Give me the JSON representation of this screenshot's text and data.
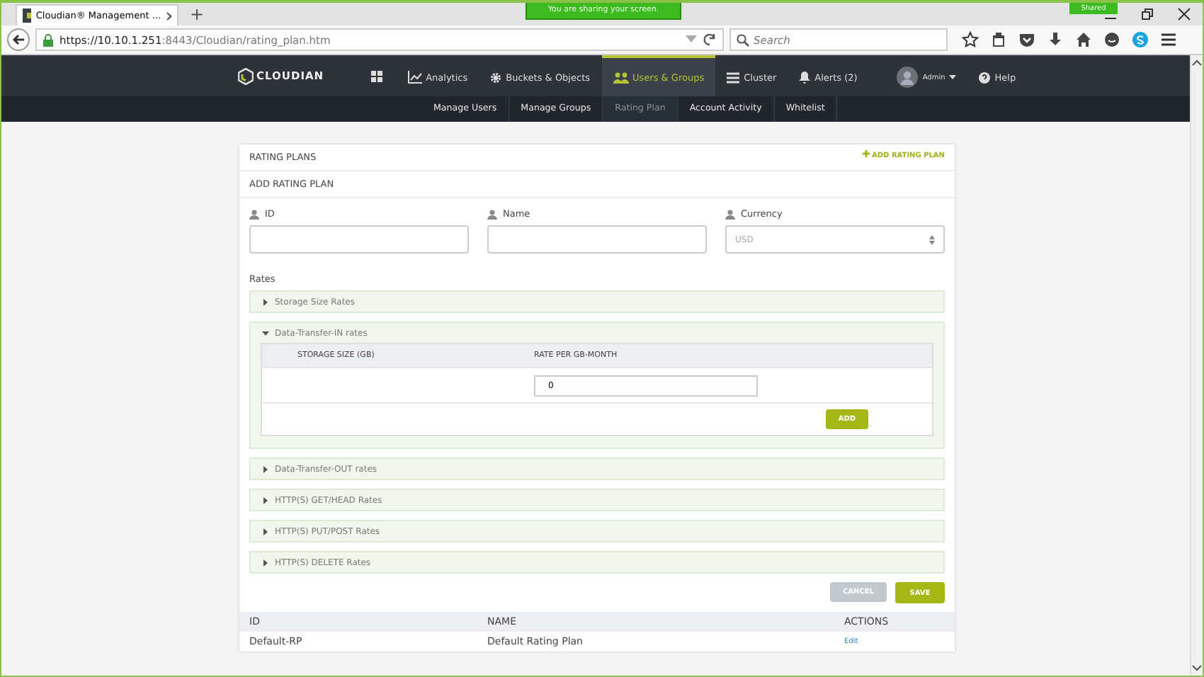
{
  "browser": {
    "tab_title": "Cloudian® Management ...",
    "new_tab": "+",
    "sharing_banner": "You are sharing your screen.",
    "shared_badge": "Shared",
    "url_host": "https://10.10.1.251",
    "url_path": ":8443/Cloudian/rating_plan.htm",
    "search": {
      "placeholder": "Search"
    }
  },
  "nav": {
    "logo": "CLOUDIAN",
    "items": [
      {
        "label": "Analytics",
        "kind": "chart",
        "selected": false
      },
      {
        "label": "Buckets & Objects",
        "kind": "gear",
        "selected": false
      },
      {
        "label": "Users & Groups",
        "kind": "users",
        "selected": true
      },
      {
        "label": "Cluster",
        "kind": "list",
        "selected": false
      },
      {
        "label": "Alerts (2)",
        "kind": "bell",
        "selected": false
      }
    ],
    "user": "Admin",
    "help": "Help"
  },
  "subnav": [
    {
      "label": "Manage Users",
      "selected": false
    },
    {
      "label": "Manage Groups",
      "selected": false
    },
    {
      "label": "Rating Plan",
      "selected": true
    },
    {
      "label": "Account Activity",
      "selected": false
    },
    {
      "label": "Whitelist",
      "selected": false
    }
  ],
  "panel": {
    "title": "RATING PLANS",
    "add_link": "ADD RATING PLAN",
    "subtitle": "ADD RATING PLAN",
    "fields": [
      {
        "label": "ID",
        "kind": "text"
      },
      {
        "label": "Name",
        "kind": "text"
      },
      {
        "label": "Currency",
        "kind": "select",
        "value": "USD"
      }
    ],
    "rates_label": "Rates",
    "sections": [
      {
        "label": "Storage Size Rates",
        "expanded": false
      },
      {
        "label": "Data-Transfer-IN rates",
        "expanded": true,
        "columns": [
          "STORAGE SIZE (GB)",
          "RATE PER GB-MONTH"
        ],
        "rate_value": "0",
        "add_button": "ADD"
      },
      {
        "label": "Data-Transfer-OUT rates",
        "expanded": false
      },
      {
        "label": "HTTP(S) GET/HEAD Rates",
        "expanded": false
      },
      {
        "label": "HTTP(S) PUT/POST Rates",
        "expanded": false
      },
      {
        "label": "HTTP(S) DELETE Rates",
        "expanded": false
      }
    ],
    "buttons": [
      {
        "label": "CANCEL",
        "disabled": true
      },
      {
        "label": "SAVE",
        "disabled": false
      }
    ]
  },
  "table": {
    "columns": [
      "ID",
      "NAME",
      "ACTIONS"
    ],
    "rows": [
      {
        "id": "Default-RP",
        "name": "Default Rating Plan",
        "action": "Edit"
      }
    ]
  }
}
